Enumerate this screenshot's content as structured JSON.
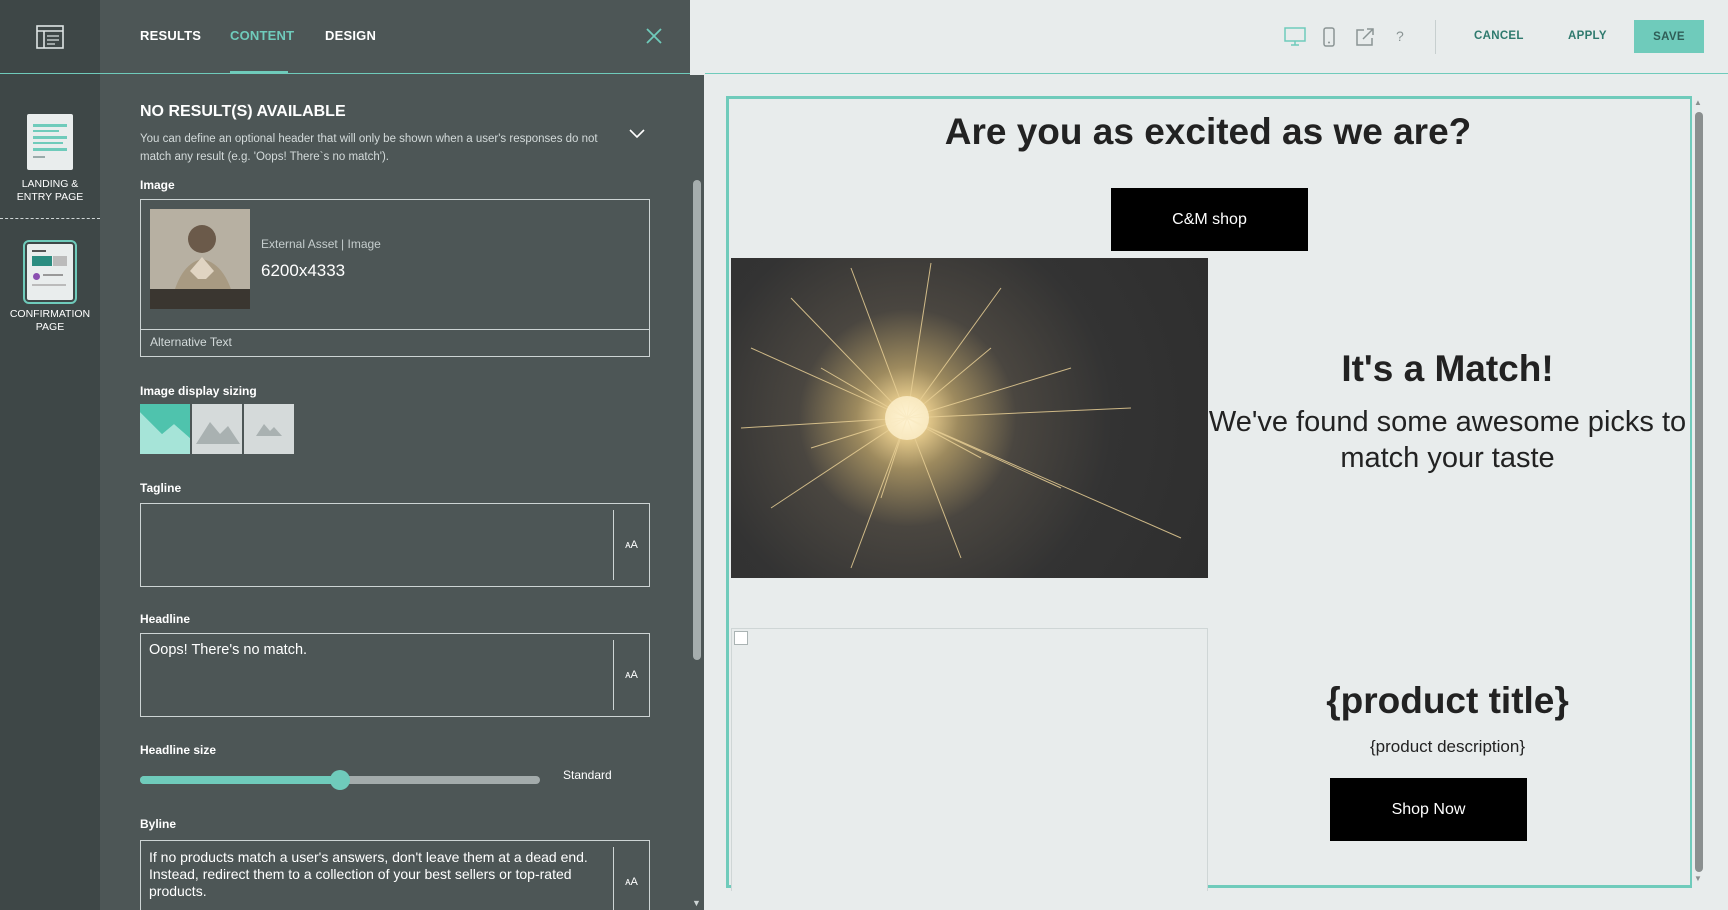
{
  "rail": {
    "pages": [
      {
        "label_line1": "LANDING &",
        "label_line2": "ENTRY PAGE"
      },
      {
        "label_line1": "CONFIRMATION",
        "label_line2": "PAGE"
      }
    ]
  },
  "tabs": {
    "results": "RESULTS",
    "content": "CONTENT",
    "design": "DESIGN"
  },
  "section": {
    "title": "NO RESULT(S) AVAILABLE",
    "description": "You can define an optional header that will only be shown when a user's responses do not match any result (e.g. 'Oops! There`s no match')."
  },
  "image": {
    "label": "Image",
    "meta": "External Asset | Image",
    "dimensions": "6200x4333",
    "alt_placeholder": "Alternative Text"
  },
  "sizing": {
    "label": "Image display sizing"
  },
  "tagline": {
    "label": "Tagline",
    "value": ""
  },
  "headline": {
    "label": "Headline",
    "value": "Oops! There's no match."
  },
  "headline_size": {
    "label": "Headline size",
    "value_label": "Standard",
    "level": 0.5
  },
  "byline": {
    "label": "Byline",
    "value": "If no products match a user's answers, don't leave them at a dead end. Instead, redirect them to a collection of your best sellers or top-rated products."
  },
  "aa_label": "ᴀA",
  "toolbar": {
    "cancel": "CANCEL",
    "apply": "APPLY",
    "save": "SAVE",
    "help": "?"
  },
  "preview": {
    "heading": "Are you as excited as we are?",
    "shop_button": "C&M shop",
    "match_heading": "It's a Match!",
    "match_sub": "We've found some awesome picks to match your taste",
    "product_title": "{product title}",
    "product_description": "{product description}",
    "product_button": "Shop Now"
  },
  "colors": {
    "accent": "#6fcbbb",
    "panel": "#4d5656",
    "rail": "#3e4747"
  }
}
